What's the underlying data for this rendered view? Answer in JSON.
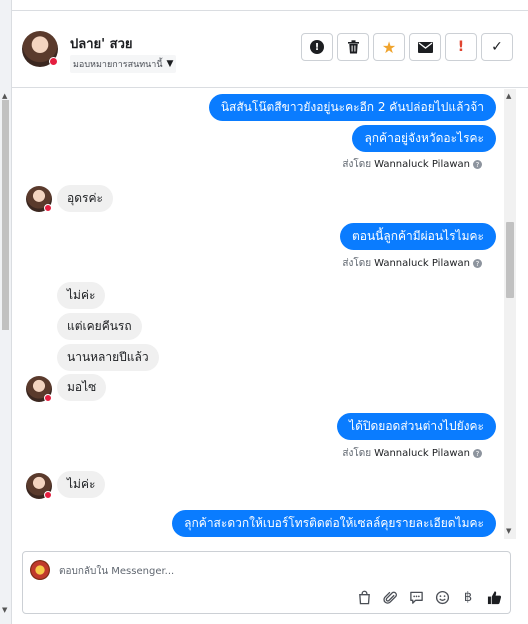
{
  "contact": {
    "name": "ปลาย' สวย",
    "assign_label": "มอบหมายการสนทนานี้"
  },
  "header_actions": [
    {
      "name": "mark-spam-button",
      "icon": "exclamation-circle-icon"
    },
    {
      "name": "delete-button",
      "icon": "trash-icon"
    },
    {
      "name": "star-button",
      "icon": "star-icon"
    },
    {
      "name": "mark-unread-button",
      "icon": "envelope-icon"
    },
    {
      "name": "follow-up-button",
      "icon": "exclamation-icon"
    },
    {
      "name": "mark-done-button",
      "icon": "checkmark-icon"
    }
  ],
  "messages": {
    "m1": "นิสสันโน๊ตสีขาวยังอยู่นะคะอีก 2 คันปล่อยไปแล้วจ้า",
    "m2": "ลุกค้าอยู่จังหวัดอะไรคะ",
    "sent_by_prefix": "ส่งโดย",
    "sent_by_name": "Wannaluck Pilawan",
    "m3": "อุดรค่ะ",
    "m4": "ตอนนี้ลูกค้ามีผ่อนไรไมคะ",
    "m5": "ไม่ค่ะ",
    "m6": "แต่เคยคีนรถ",
    "m7": "นานหลายปีแล้ว",
    "m8": "มอไซ",
    "m9": "ได้ปิดยอดส่วนต่างไปยังคะ",
    "m10": "ไม่ค่ะ",
    "m11": "ลุกค้าสะดวกให้เบอร์โทรติดต่อให้เซลล์คุยรายละเอียดไมคะ"
  },
  "composer": {
    "placeholder": "ตอบกลับใน Messenger..."
  },
  "colors": {
    "outgoing": "#0a7cff",
    "incoming": "#f0f0f0",
    "star": "#f0a42e",
    "alert": "#e0442f"
  }
}
